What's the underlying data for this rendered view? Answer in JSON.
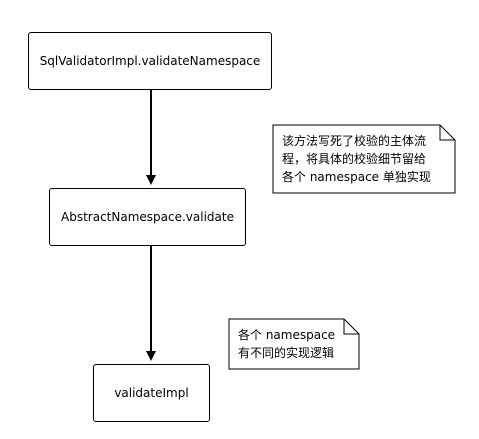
{
  "nodes": {
    "sql_validator": "SqlValidatorImpl.validateNamespace",
    "abstract_namespace": "AbstractNamespace.validate",
    "validate_impl": "validateImpl"
  },
  "notes": {
    "main_flow": "该方法写死了校验的主体流\n程，将具体的校验细节留给\n各个 namespace 单独实现",
    "impl_logic": "各个 namespace\n有不同的实现逻辑"
  },
  "colors": {
    "stroke": "#000000",
    "fill": "#ffffff"
  }
}
